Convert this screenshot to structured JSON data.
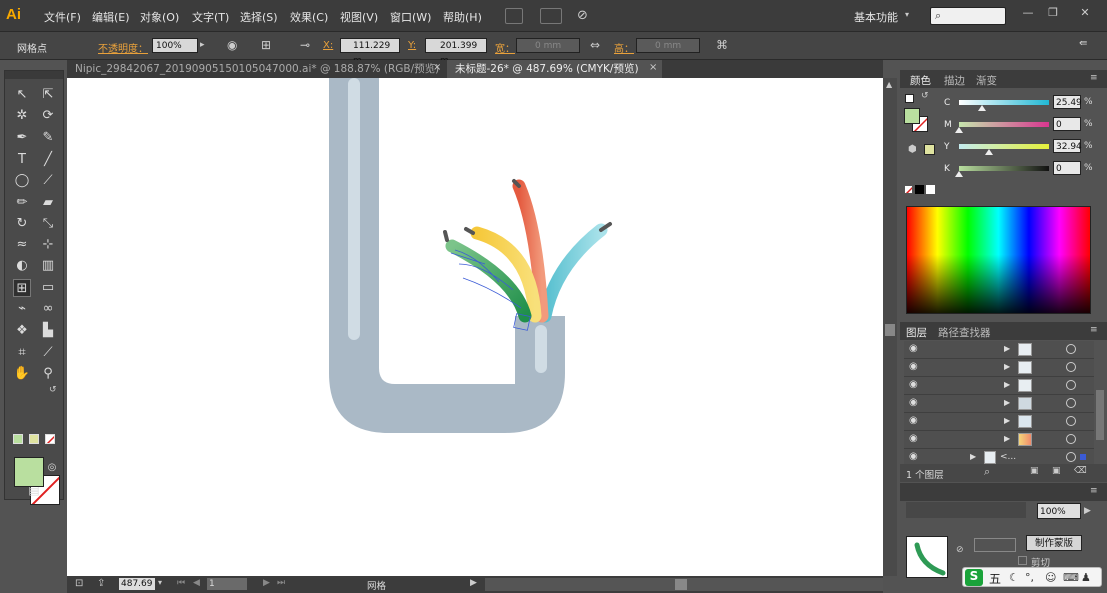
{
  "app": {
    "logo": "Ai"
  },
  "menu": [
    "文件(F)",
    "编辑(E)",
    "对象(O)",
    "文字(T)",
    "选择(S)",
    "效果(C)",
    "视图(V)",
    "窗口(W)",
    "帮助(H)"
  ],
  "workspace_label": "基本功能",
  "window_buttons": [
    "—",
    "❐",
    "✕"
  ],
  "control": {
    "selection_label": "网格点",
    "opacity_label": "不透明度：",
    "opacity_value": "100%",
    "x_label": "X:",
    "x_value": "111.229 m",
    "y_label": "Y:",
    "y_value": "201.399 m",
    "w_label": "宽：",
    "w_value": "0 mm",
    "h_label": "高：",
    "h_value": "0 mm"
  },
  "tabs": [
    {
      "label": "Nipic_29842067_20190905150105047000.ai* @ 188.87% (RGB/预览)",
      "close": "×"
    },
    {
      "label": "未标题-26* @ 487.69% (CMYK/预览)",
      "close": "×"
    }
  ],
  "status": {
    "zoom": "487.69",
    "page": "1",
    "mode": "网格"
  },
  "color_panel": {
    "tabs": [
      "颜色",
      "描边",
      "渐变"
    ],
    "sliders": [
      {
        "label": "C",
        "value": "25.49",
        "unit": "%",
        "level": 0.25
      },
      {
        "label": "M",
        "value": "0",
        "unit": "%",
        "level": 0
      },
      {
        "label": "Y",
        "value": "32.94",
        "unit": "%",
        "level": 0.33
      },
      {
        "label": "K",
        "value": "0",
        "unit": "%",
        "level": 0
      }
    ],
    "fill_color": "#b9df9f"
  },
  "layers_panel": {
    "tabs": [
      "图层",
      "路径查找器"
    ],
    "count_label": "1 个图层",
    "last_row_label": "<..."
  },
  "transparency_panel": {
    "opacity_value": "100%",
    "mask_button": "制作蒙版",
    "clip_label": "剪切"
  },
  "colors": {
    "accent": "#f7a800",
    "pipe": "#aab9c6",
    "pipe_highlight": "#d0dce4"
  }
}
